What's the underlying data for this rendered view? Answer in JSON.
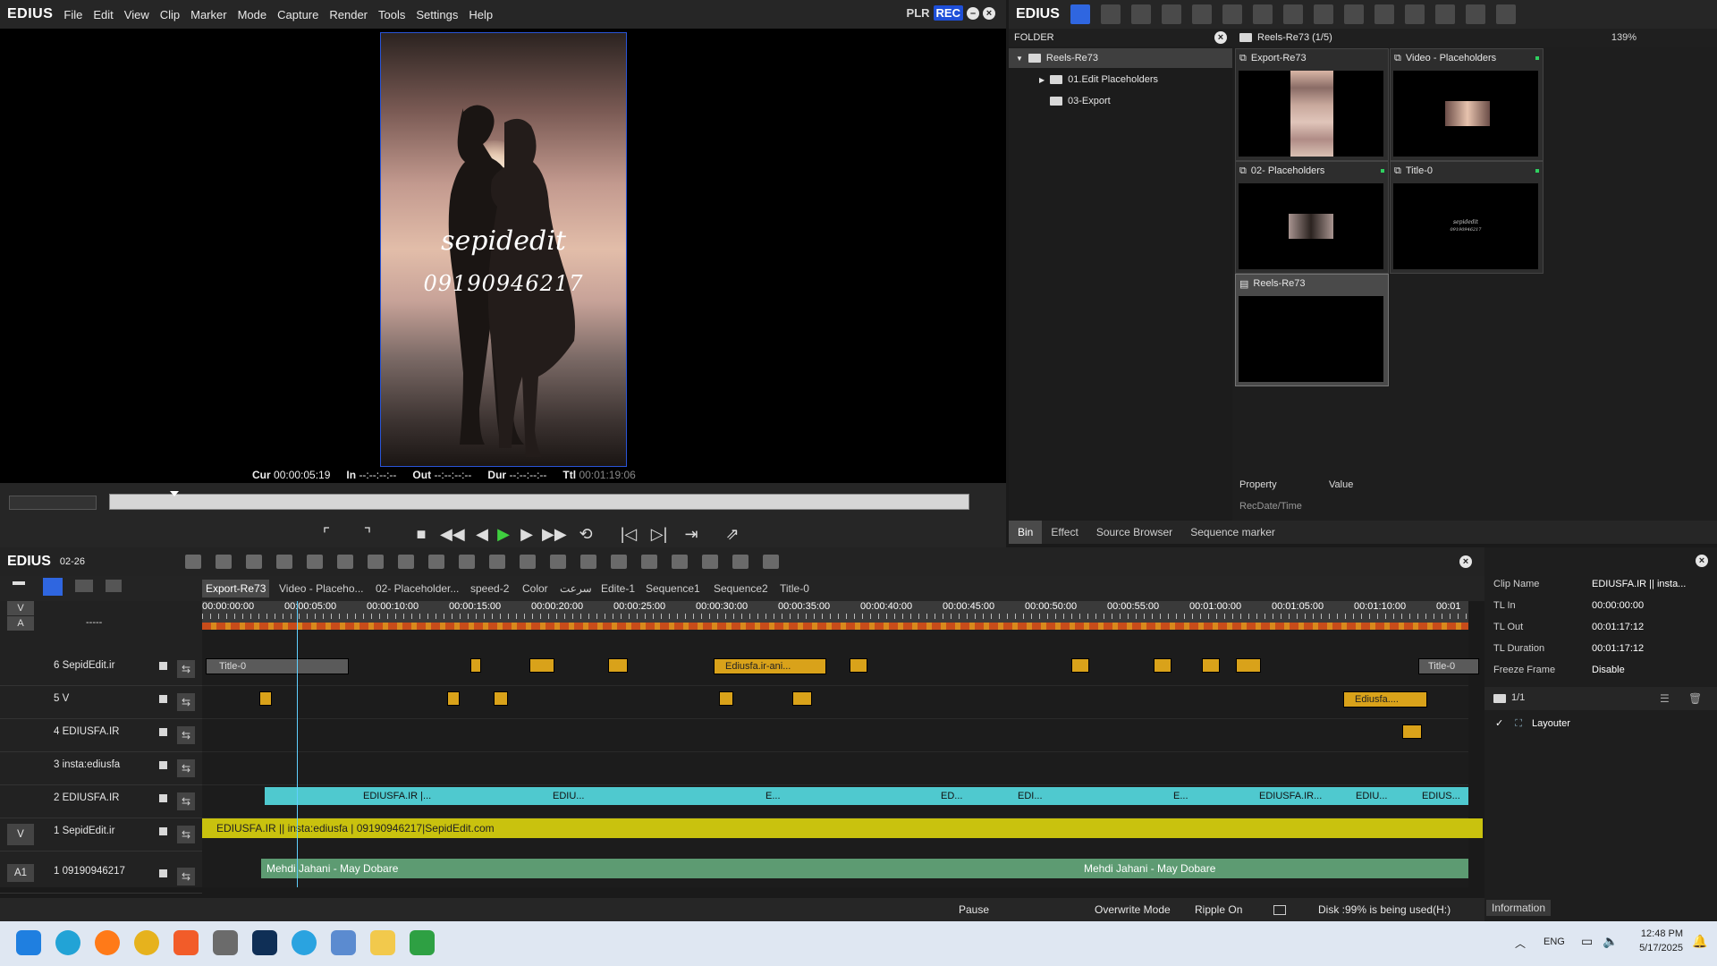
{
  "app": {
    "name": "EDIUS",
    "menu": [
      "File",
      "Edit",
      "View",
      "Clip",
      "Marker",
      "Mode",
      "Capture",
      "Render",
      "Tools",
      "Settings",
      "Help"
    ],
    "plr": "PLR",
    "rec": "REC"
  },
  "player": {
    "watermark_text": "sepidedit",
    "watermark_phone": "09190946217",
    "timecodes": {
      "cur_label": "Cur",
      "cur": "00:00:05:19",
      "in_label": "In",
      "in": "--:--:--:--",
      "out_label": "Out",
      "out": "--:--:--:--",
      "dur_label": "Dur",
      "dur": "--:--:--:--",
      "ttl_label": "Ttl",
      "ttl": "00:01:19:06"
    }
  },
  "bin": {
    "logo": "EDIUS",
    "folder_header": "FOLDER",
    "bin_header": "Reels-Re73 (1/5)",
    "zoom": "139%",
    "folders": [
      "Reels-Re73",
      "01.Edit Placeholders",
      "03-Export"
    ],
    "clips": [
      {
        "name": "Export-Re73"
      },
      {
        "name": "Video - Placeholders"
      },
      {
        "name": "02- Placeholders"
      },
      {
        "name": "Title-0"
      },
      {
        "name": "Reels-Re73"
      }
    ],
    "title_thumb_line1": "sepidedit",
    "title_thumb_line2": "09190946217",
    "property_col": "Property",
    "value_col": "Value",
    "property_row": "RecDate/Time",
    "tabs": [
      "Bin",
      "Effect",
      "Source Browser",
      "Sequence marker"
    ]
  },
  "timeline": {
    "logo": "EDIUS",
    "project": "02-26",
    "sequence_tabs": [
      "Export-Re73",
      "Video - Placeho...",
      "02- Placeholder...",
      "speed-2",
      "Color",
      "سرعت",
      "Edite-1",
      "Sequence1",
      "Sequence2",
      "Title-0"
    ],
    "ruler": [
      "00:00:00:00",
      "00:00:05:00",
      "00:00:10:00",
      "00:00:15:00",
      "00:00:20:00",
      "00:00:25:00",
      "00:00:30:00",
      "00:00:35:00",
      "00:00:40:00",
      "00:00:45:00",
      "00:00:50:00",
      "00:00:55:00",
      "00:01:00:00",
      "00:01:05:00",
      "00:01:10:00",
      "00:01"
    ],
    "track_header": {
      "v": "V",
      "a": "A",
      "dash": "-----"
    },
    "tracks": [
      {
        "name": "6 SepidEdit.ir"
      },
      {
        "name": "5 V"
      },
      {
        "name": "4 EDIUSFA.IR"
      },
      {
        "name": "3 insta:ediusfa"
      },
      {
        "name": "2 EDIUSFA.IR"
      },
      {
        "name": "1 SepidEdit.ir",
        "tag": "V"
      },
      {
        "name": "1 09190946217",
        "tag": "A1"
      }
    ],
    "clip_labels": {
      "title0": "Title-0",
      "title0_right": "Title-0",
      "ani": "Ediusfa.ir-ani...",
      "ediusfa_short": "Ediusfa....",
      "track2": [
        "EDIUSFA.IR |...",
        "EDIU...",
        "E...",
        "ED...",
        "EDI...",
        "E...",
        "EDIUSFA.IR...",
        "EDIU...",
        "EDIUS..."
      ],
      "v1": "EDIUSFA.IR || insta:ediusfa |  09190946217|SepidEdit.com",
      "a1_a": "Mehdi Jahani - May Dobare",
      "a1_b": "Mehdi Jahani - May Dobare"
    }
  },
  "status": {
    "state": "Pause",
    "mode": "Overwrite Mode",
    "ripple": "Ripple On",
    "disk": "Disk :99% is being used(H:)"
  },
  "info": {
    "rows": [
      {
        "k": "Clip Name",
        "v": "EDIUSFA.IR || insta..."
      },
      {
        "k": "TL In",
        "v": "00:00:00:00"
      },
      {
        "k": "TL Out",
        "v": "00:01:17:12"
      },
      {
        "k": "TL Duration",
        "v": "00:01:17:12"
      },
      {
        "k": "Freeze Frame",
        "v": "Disable"
      }
    ],
    "page": "1/1",
    "layouter": "Layouter",
    "tab": "Information"
  },
  "taskbar": {
    "lang": "ENG",
    "time": "12:48 PM",
    "date": "5/17/2025"
  },
  "colors": {
    "accent_blue": "#2f66e0",
    "clip_yellow": "#d9a21a",
    "clip_cyan": "#4fc9cf",
    "clip_green": "#5d9b72",
    "v1_yellow": "#c9c20e"
  }
}
